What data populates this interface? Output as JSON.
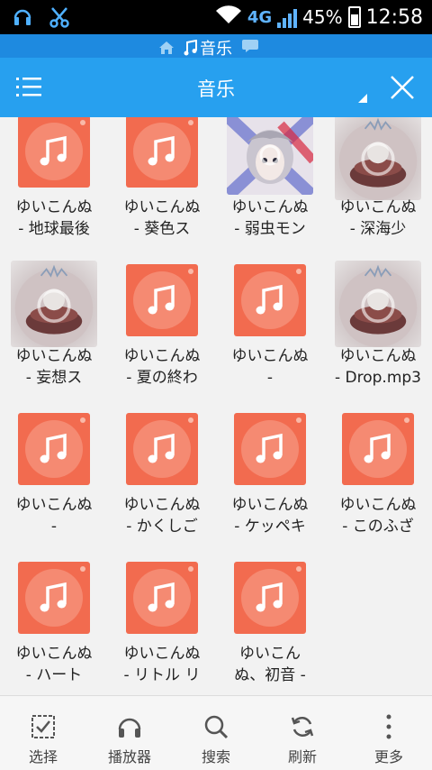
{
  "status_bar": {
    "network": "4G",
    "battery": "45%",
    "time": "12:58"
  },
  "path_bar": {
    "current": "音乐"
  },
  "title_bar": {
    "title": "音乐"
  },
  "files": [
    {
      "line1": "ゆいこんぬ",
      "line2": "- 地球最後",
      "thumb": "music"
    },
    {
      "line1": "ゆいこんぬ",
      "line2": "- 葵色ス",
      "thumb": "music"
    },
    {
      "line1": "ゆいこんぬ",
      "line2": "- 弱虫モン",
      "thumb": "art"
    },
    {
      "line1": "ゆいこんぬ",
      "line2": "- 深海少",
      "thumb": "photo"
    },
    {
      "line1": "ゆいこんぬ",
      "line2": "- 妄想ス",
      "thumb": "photo"
    },
    {
      "line1": "ゆいこんぬ",
      "line2": "- 夏の終わ",
      "thumb": "music"
    },
    {
      "line1": "ゆいこんぬ",
      "line2": "-",
      "thumb": "music"
    },
    {
      "line1": "ゆいこんぬ",
      "line2": "- Drop.mp3",
      "thumb": "photo"
    },
    {
      "line1": "ゆいこんぬ",
      "line2": "-",
      "thumb": "music"
    },
    {
      "line1": "ゆいこんぬ",
      "line2": "- かくしご",
      "thumb": "music"
    },
    {
      "line1": "ゆいこんぬ",
      "line2": "- ケッペキ",
      "thumb": "music"
    },
    {
      "line1": "ゆいこんぬ",
      "line2": "- このふざ",
      "thumb": "music"
    },
    {
      "line1": "ゆいこんぬ",
      "line2": "- ハート",
      "thumb": "music"
    },
    {
      "line1": "ゆいこんぬ",
      "line2": "- リトル リ",
      "thumb": "music"
    },
    {
      "line1": "ゆいこん",
      "line2": "ぬ、初音 -",
      "thumb": "music"
    }
  ],
  "bottom_nav": [
    {
      "label": "选择",
      "icon": "select-checkbox-icon"
    },
    {
      "label": "播放器",
      "icon": "headphones-icon"
    },
    {
      "label": "搜索",
      "icon": "search-icon"
    },
    {
      "label": "刷新",
      "icon": "refresh-icon"
    },
    {
      "label": "更多",
      "icon": "more-vertical-icon"
    }
  ],
  "colors": {
    "title_bar": "#27a0ef",
    "path_strip": "#1e8ae0",
    "music_thumb": "#f26b4f"
  }
}
